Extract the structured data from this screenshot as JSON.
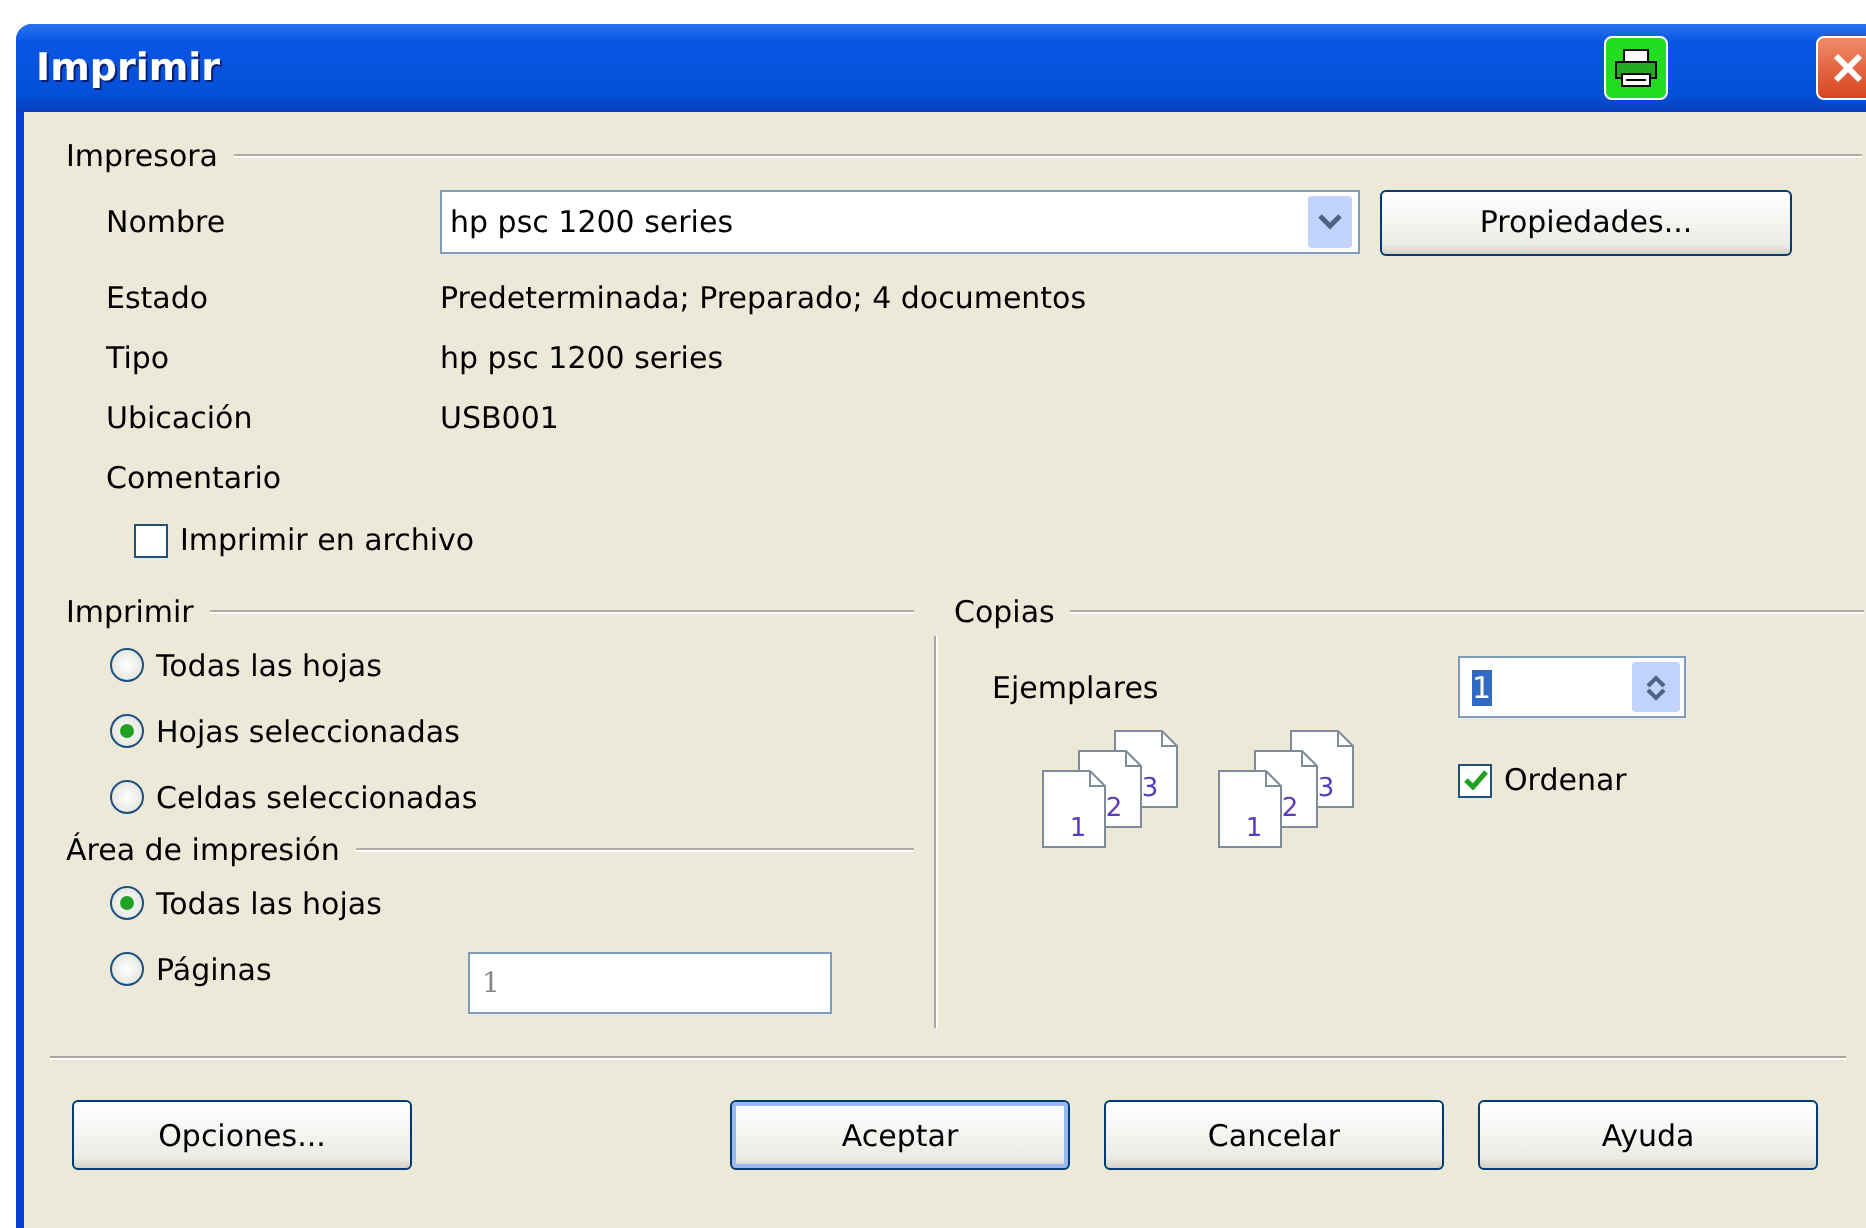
{
  "window": {
    "title": "Imprimir"
  },
  "printer": {
    "heading": "Impresora",
    "name_label": "Nombre",
    "name_value": "hp psc 1200 series",
    "properties_button": "Propiedades...",
    "info": [
      {
        "label": "Estado",
        "value": "Predeterminada; Preparado; 4 documentos"
      },
      {
        "label": "Tipo",
        "value": "hp psc 1200 series"
      },
      {
        "label": "Ubicación",
        "value": "USB001"
      },
      {
        "label": "Comentario"
      }
    ],
    "print_to_file": {
      "label": "Imprimir en archivo",
      "checked": false
    }
  },
  "print_range": {
    "heading": "Imprimir",
    "options": [
      {
        "label": "Todas las hojas",
        "selected": false
      },
      {
        "label": "Hojas seleccionadas",
        "selected": true
      },
      {
        "label": "Celdas seleccionadas",
        "selected": false
      }
    ]
  },
  "print_area": {
    "heading": "Área de impresión",
    "options": [
      {
        "label": "Todas las hojas",
        "selected": true
      },
      {
        "label": "Páginas",
        "selected": false
      }
    ],
    "pages_field": {
      "value": "1",
      "disabled": true
    }
  },
  "copies": {
    "heading": "Copias",
    "count_label": "Ejemplares",
    "count_value": "1",
    "illustrations": [
      {
        "pages": [
          "1",
          "2",
          "3"
        ]
      },
      {
        "pages": [
          "1",
          "2",
          "3"
        ]
      }
    ],
    "collate": {
      "label": "Ordenar",
      "checked": true
    }
  },
  "buttons": [
    {
      "label": "Opciones...",
      "default": false
    },
    {
      "label": "Aceptar",
      "default": true
    },
    {
      "label": "Cancelar",
      "default": false
    },
    {
      "label": "Ayuda",
      "default": false
    }
  ]
}
